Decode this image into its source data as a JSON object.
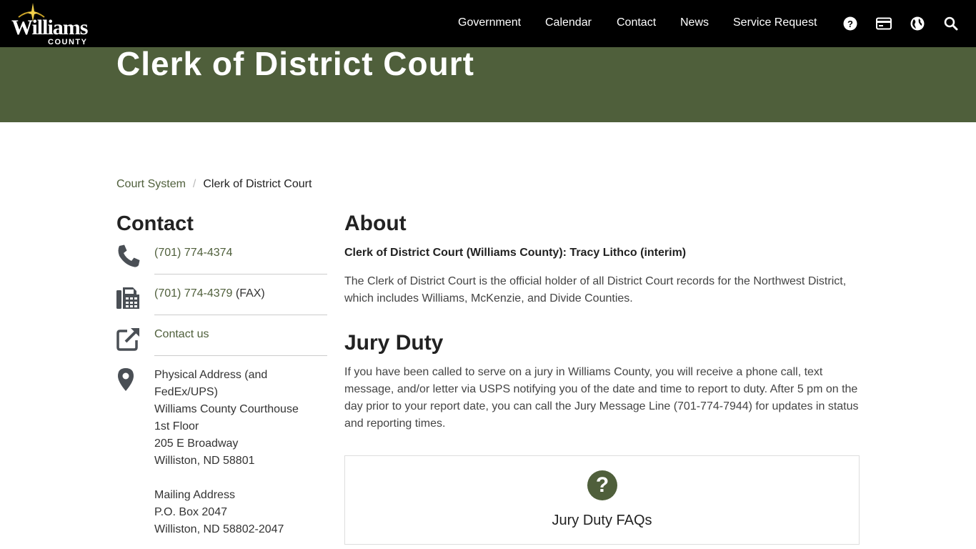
{
  "header": {
    "logo_text": "Williams",
    "logo_subtext": "COUNTY",
    "nav": [
      {
        "label": "Government"
      },
      {
        "label": "Calendar"
      },
      {
        "label": "Contact"
      },
      {
        "label": "News"
      },
      {
        "label": "Service Request"
      }
    ],
    "icons": [
      "help-icon",
      "payment-card-icon",
      "globe-icon",
      "search-icon"
    ]
  },
  "banner": {
    "title": "Clerk of District Court",
    "color": "#4f5f3b"
  },
  "breadcrumb": {
    "parent": "Court System",
    "separator": "/",
    "current": "Clerk of District Court"
  },
  "contact": {
    "title": "Contact",
    "phone": "(701) 774-4374",
    "fax_number": "(701) 774-4379",
    "fax_suffix": " (FAX)",
    "contact_link": "Contact us",
    "address_lines": [
      "Physical Address (and",
      "FedEx/UPS)",
      "Williams County Courthouse",
      "1st Floor",
      "205 E Broadway",
      "Williston, ND 58801",
      "",
      "Mailing Address",
      "P.O. Box 2047",
      "Williston, ND 58802-2047"
    ]
  },
  "about": {
    "title": "About",
    "clerk_line": "Clerk of District Court (Williams County): Tracy Lithco (interim)",
    "description": "The Clerk of District Court is the official holder of all District Court records for the Northwest District, which includes Williams, McKenzie, and Divide Counties."
  },
  "jury": {
    "title": "Jury Duty",
    "description": "If you have been called to serve on a jury in Williams County, you will receive a phone call, text message, and/or letter via USPS notifying you of the date and time to report to duty. After 5 pm on the day prior to your report date, you can call the Jury Message Line (701-774-7944) for updates in status and reporting times.",
    "faq_symbol": "?",
    "faq_label": "Jury Duty FAQs"
  },
  "colors": {
    "accent": "#4f5f3b",
    "header_bg": "#000000",
    "icon_gray": "#4a4f55"
  }
}
